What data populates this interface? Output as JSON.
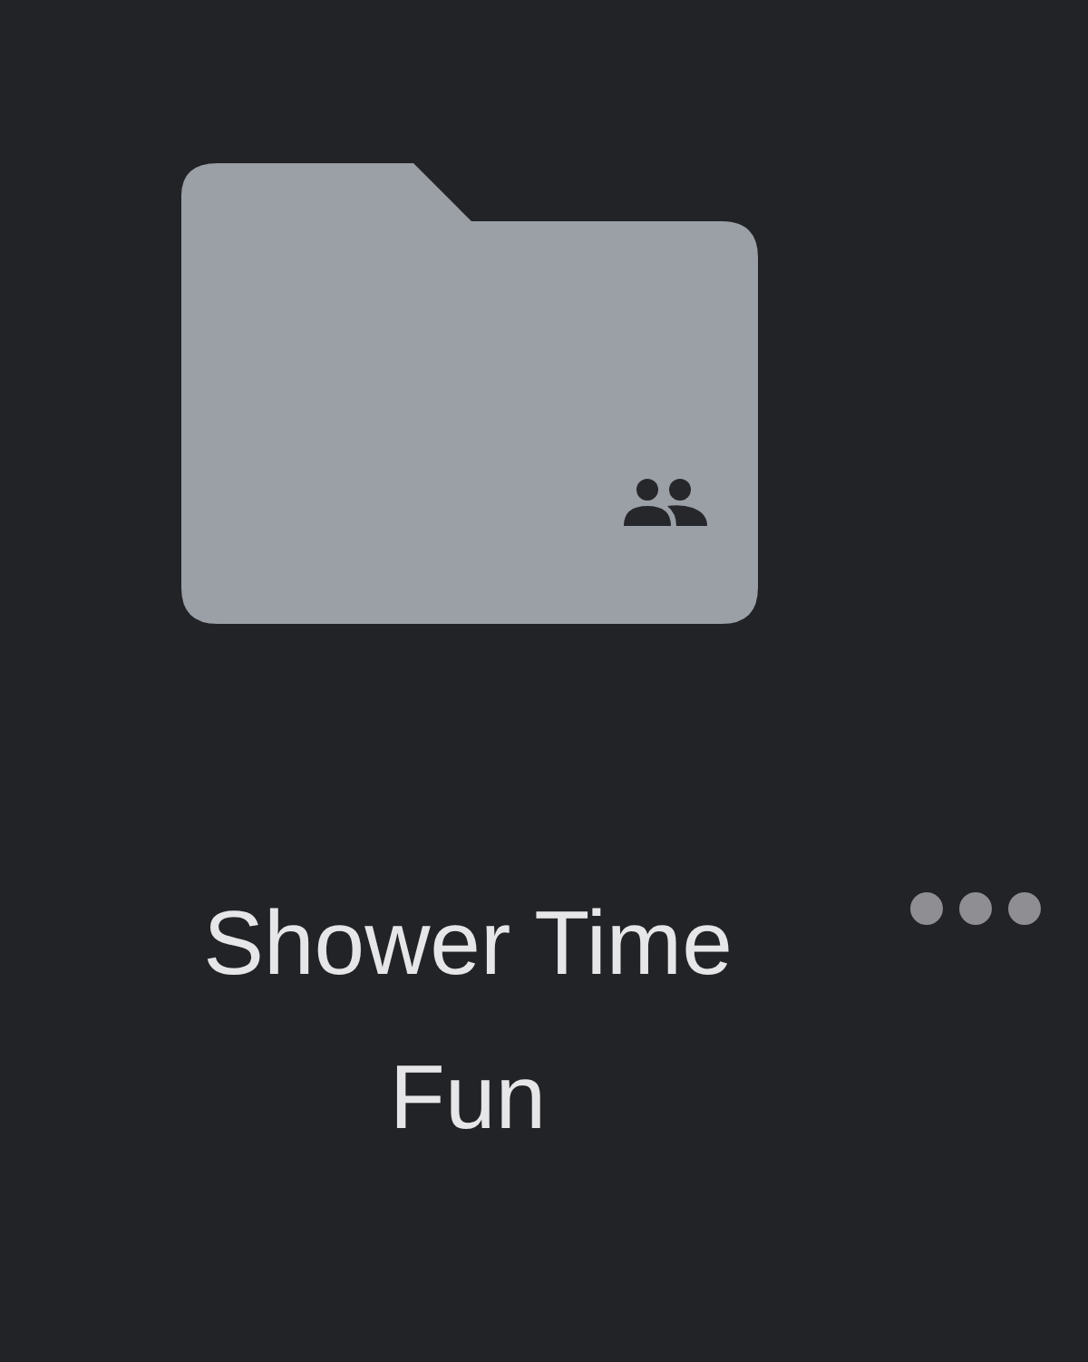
{
  "folder": {
    "name": "Shower Time Fun",
    "shared": true
  }
}
